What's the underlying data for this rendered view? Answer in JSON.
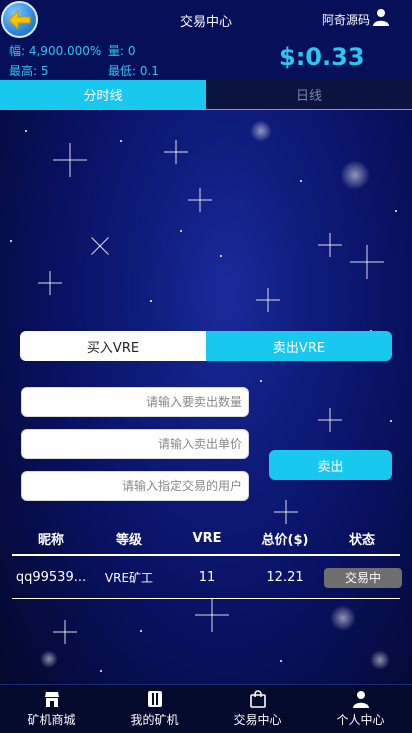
{
  "header": {
    "title": "交易中心",
    "user_name": "阿奇源码",
    "change": "幅: 4,900.000%",
    "volume": "量: 0",
    "high": "最高: 5",
    "low": "最低: 0.1",
    "price": "$:0.33"
  },
  "chart_tabs": [
    {
      "label": "分时线",
      "active": true
    },
    {
      "label": "日线",
      "active": false
    }
  ],
  "trade": {
    "buy_label": "买入VRE",
    "sell_label": "卖出VRE",
    "quantity_placeholder": "请输入要卖出数量",
    "unit_price_placeholder": "请输入卖出单价",
    "user_placeholder": "请输入指定交易的用户",
    "submit_label": "卖出"
  },
  "table": {
    "headers": [
      "昵称",
      "等级",
      "VRE",
      "总价($)",
      "状态"
    ],
    "rows": [
      {
        "nickname": "qq99539...",
        "level": "VRE矿工",
        "vre": "11",
        "total": "12.21",
        "status": "交易中"
      }
    ]
  },
  "bottom_nav": [
    {
      "label": "矿机商城",
      "icon": "shop-icon"
    },
    {
      "label": "我的矿机",
      "icon": "machine-icon"
    },
    {
      "label": "交易中心",
      "icon": "bag-icon"
    },
    {
      "label": "个人中心",
      "icon": "person-icon"
    }
  ],
  "colors": {
    "accent": "#19c8ef",
    "header_bg": "#061058",
    "status_badge": "#6e6e6e"
  }
}
